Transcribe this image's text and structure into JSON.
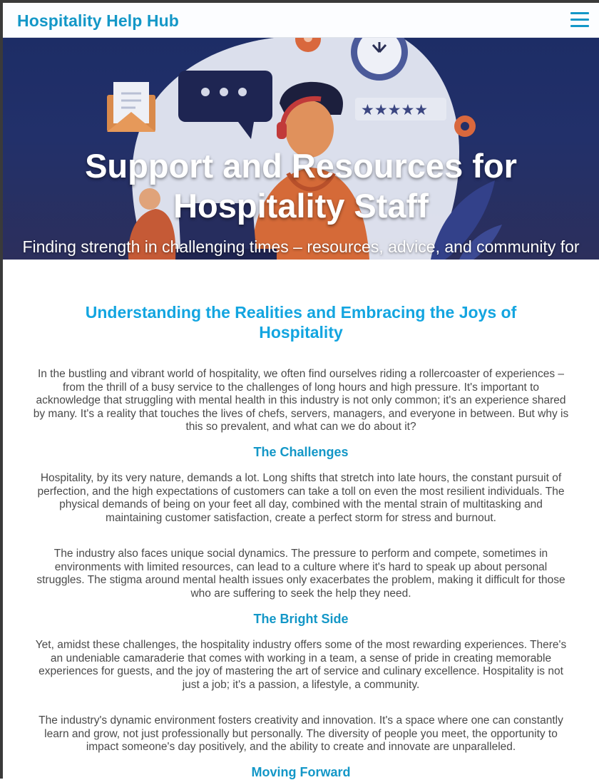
{
  "navbar": {
    "brand": "Hospitality Help Hub",
    "menu_icon": "hamburger-menu-icon"
  },
  "hero": {
    "title": "Support and Resources for Hospitality Staff",
    "subtitle": "Finding strength in challenging times – resources, advice, and community for hospitality staff."
  },
  "main": {
    "heading": "Understanding the Realities and Embracing the Joys of Hospitality",
    "intro": "In the bustling and vibrant world of hospitality, we often find ourselves riding a rollercoaster of experiences – from the thrill of a busy service to the challenges of long hours and high pressure. It's important to acknowledge that struggling with mental health in this industry is not only common; it's an experience shared by many. It's a reality that touches the lives of chefs, servers, managers, and everyone in between. But why is this so prevalent, and what can we do about it?",
    "challenges": {
      "heading": "The Challenges",
      "p1": "Hospitality, by its very nature, demands a lot. Long shifts that stretch into late hours, the constant pursuit of perfection, and the high expectations of customers can take a toll on even the most resilient individuals. The physical demands of being on your feet all day, combined with the mental strain of multitasking and maintaining customer satisfaction, create a perfect storm for stress and burnout.",
      "p2": "The industry also faces unique social dynamics. The pressure to perform and compete, sometimes in environments with limited resources, can lead to a culture where it's hard to speak up about personal struggles. The stigma around mental health issues only exacerbates the problem, making it difficult for those who are suffering to seek the help they need."
    },
    "bright_side": {
      "heading": "The Bright Side",
      "p1": "Yet, amidst these challenges, the hospitality industry offers some of the most rewarding experiences. There's an undeniable camaraderie that comes with working in a team, a sense of pride in creating memorable experiences for guests, and the joy of mastering the art of service and culinary excellence. Hospitality is not just a job; it's a passion, a lifestyle, a community.",
      "p2": "The industry's dynamic environment fosters creativity and innovation. It's a space where one can constantly learn and grow, not just professionally but personally. The diversity of people you meet, the opportunity to impact someone's day positively, and the ability to create and innovate are unparalleled."
    },
    "moving_forward": {
      "heading": "Moving Forward"
    }
  },
  "colors": {
    "brand": "#1397c7",
    "heading_accent": "#13a5e0",
    "body_text": "#4a4a4a",
    "hero_bg": "#1d2d66"
  }
}
